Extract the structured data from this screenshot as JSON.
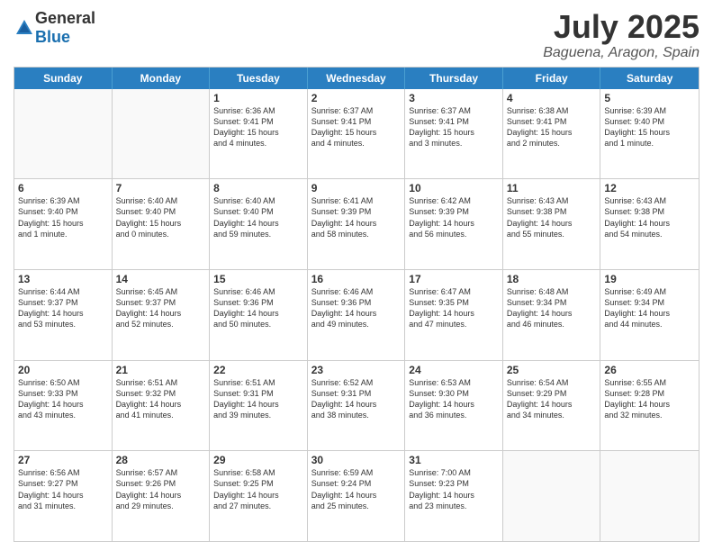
{
  "header": {
    "logo_general": "General",
    "logo_blue": "Blue",
    "month": "July 2025",
    "location": "Baguena, Aragon, Spain"
  },
  "days_of_week": [
    "Sunday",
    "Monday",
    "Tuesday",
    "Wednesday",
    "Thursday",
    "Friday",
    "Saturday"
  ],
  "weeks": [
    [
      {
        "day": "",
        "text": "",
        "empty": true
      },
      {
        "day": "",
        "text": "",
        "empty": true
      },
      {
        "day": "1",
        "text": "Sunrise: 6:36 AM\nSunset: 9:41 PM\nDaylight: 15 hours\nand 4 minutes."
      },
      {
        "day": "2",
        "text": "Sunrise: 6:37 AM\nSunset: 9:41 PM\nDaylight: 15 hours\nand 4 minutes."
      },
      {
        "day": "3",
        "text": "Sunrise: 6:37 AM\nSunset: 9:41 PM\nDaylight: 15 hours\nand 3 minutes."
      },
      {
        "day": "4",
        "text": "Sunrise: 6:38 AM\nSunset: 9:41 PM\nDaylight: 15 hours\nand 2 minutes."
      },
      {
        "day": "5",
        "text": "Sunrise: 6:39 AM\nSunset: 9:40 PM\nDaylight: 15 hours\nand 1 minute."
      }
    ],
    [
      {
        "day": "6",
        "text": "Sunrise: 6:39 AM\nSunset: 9:40 PM\nDaylight: 15 hours\nand 1 minute."
      },
      {
        "day": "7",
        "text": "Sunrise: 6:40 AM\nSunset: 9:40 PM\nDaylight: 15 hours\nand 0 minutes."
      },
      {
        "day": "8",
        "text": "Sunrise: 6:40 AM\nSunset: 9:40 PM\nDaylight: 14 hours\nand 59 minutes."
      },
      {
        "day": "9",
        "text": "Sunrise: 6:41 AM\nSunset: 9:39 PM\nDaylight: 14 hours\nand 58 minutes."
      },
      {
        "day": "10",
        "text": "Sunrise: 6:42 AM\nSunset: 9:39 PM\nDaylight: 14 hours\nand 56 minutes."
      },
      {
        "day": "11",
        "text": "Sunrise: 6:43 AM\nSunset: 9:38 PM\nDaylight: 14 hours\nand 55 minutes."
      },
      {
        "day": "12",
        "text": "Sunrise: 6:43 AM\nSunset: 9:38 PM\nDaylight: 14 hours\nand 54 minutes."
      }
    ],
    [
      {
        "day": "13",
        "text": "Sunrise: 6:44 AM\nSunset: 9:37 PM\nDaylight: 14 hours\nand 53 minutes."
      },
      {
        "day": "14",
        "text": "Sunrise: 6:45 AM\nSunset: 9:37 PM\nDaylight: 14 hours\nand 52 minutes."
      },
      {
        "day": "15",
        "text": "Sunrise: 6:46 AM\nSunset: 9:36 PM\nDaylight: 14 hours\nand 50 minutes."
      },
      {
        "day": "16",
        "text": "Sunrise: 6:46 AM\nSunset: 9:36 PM\nDaylight: 14 hours\nand 49 minutes."
      },
      {
        "day": "17",
        "text": "Sunrise: 6:47 AM\nSunset: 9:35 PM\nDaylight: 14 hours\nand 47 minutes."
      },
      {
        "day": "18",
        "text": "Sunrise: 6:48 AM\nSunset: 9:34 PM\nDaylight: 14 hours\nand 46 minutes."
      },
      {
        "day": "19",
        "text": "Sunrise: 6:49 AM\nSunset: 9:34 PM\nDaylight: 14 hours\nand 44 minutes."
      }
    ],
    [
      {
        "day": "20",
        "text": "Sunrise: 6:50 AM\nSunset: 9:33 PM\nDaylight: 14 hours\nand 43 minutes."
      },
      {
        "day": "21",
        "text": "Sunrise: 6:51 AM\nSunset: 9:32 PM\nDaylight: 14 hours\nand 41 minutes."
      },
      {
        "day": "22",
        "text": "Sunrise: 6:51 AM\nSunset: 9:31 PM\nDaylight: 14 hours\nand 39 minutes."
      },
      {
        "day": "23",
        "text": "Sunrise: 6:52 AM\nSunset: 9:31 PM\nDaylight: 14 hours\nand 38 minutes."
      },
      {
        "day": "24",
        "text": "Sunrise: 6:53 AM\nSunset: 9:30 PM\nDaylight: 14 hours\nand 36 minutes."
      },
      {
        "day": "25",
        "text": "Sunrise: 6:54 AM\nSunset: 9:29 PM\nDaylight: 14 hours\nand 34 minutes."
      },
      {
        "day": "26",
        "text": "Sunrise: 6:55 AM\nSunset: 9:28 PM\nDaylight: 14 hours\nand 32 minutes."
      }
    ],
    [
      {
        "day": "27",
        "text": "Sunrise: 6:56 AM\nSunset: 9:27 PM\nDaylight: 14 hours\nand 31 minutes."
      },
      {
        "day": "28",
        "text": "Sunrise: 6:57 AM\nSunset: 9:26 PM\nDaylight: 14 hours\nand 29 minutes."
      },
      {
        "day": "29",
        "text": "Sunrise: 6:58 AM\nSunset: 9:25 PM\nDaylight: 14 hours\nand 27 minutes."
      },
      {
        "day": "30",
        "text": "Sunrise: 6:59 AM\nSunset: 9:24 PM\nDaylight: 14 hours\nand 25 minutes."
      },
      {
        "day": "31",
        "text": "Sunrise: 7:00 AM\nSunset: 9:23 PM\nDaylight: 14 hours\nand 23 minutes."
      },
      {
        "day": "",
        "text": "",
        "empty": true
      },
      {
        "day": "",
        "text": "",
        "empty": true
      }
    ]
  ]
}
